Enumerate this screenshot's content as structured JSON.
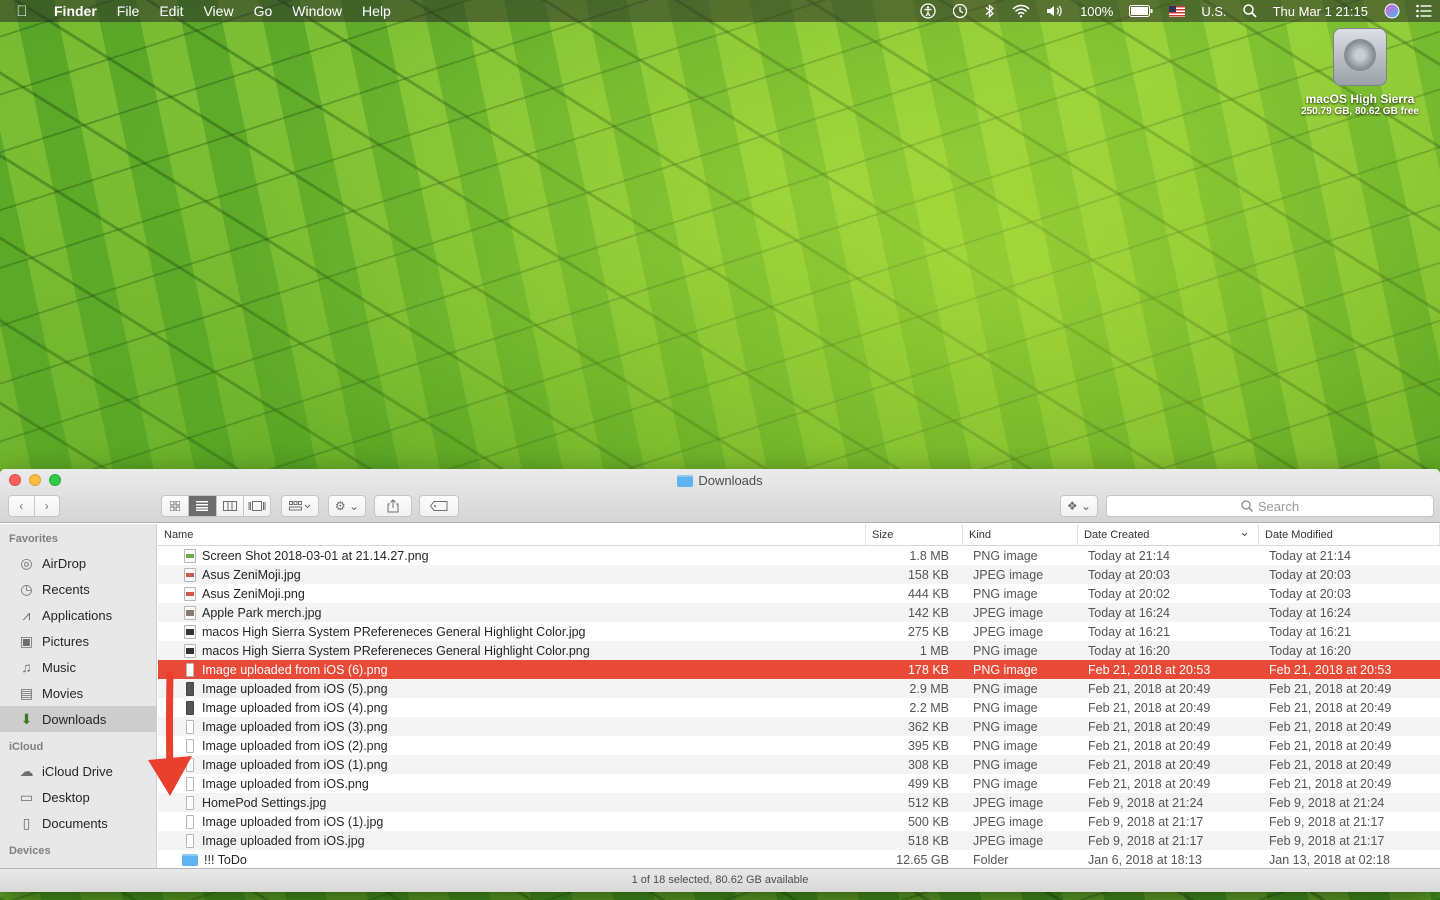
{
  "menubar": {
    "app_name": "Finder",
    "menus": [
      "File",
      "Edit",
      "View",
      "Go",
      "Window",
      "Help"
    ],
    "battery": "100%",
    "input_source": "U.S.",
    "clock": "Thu Mar 1  21:15"
  },
  "desktop": {
    "disk_name": "macOS High Sierra",
    "disk_info": "250.79 GB, 80.62 GB free"
  },
  "window": {
    "title": "Downloads",
    "search_placeholder": "Search",
    "status": "1 of 18 selected, 80.62 GB available"
  },
  "sidebar": {
    "sections": [
      {
        "heading": "Favorites",
        "items": [
          {
            "label": "AirDrop",
            "icon": "airdrop-icon",
            "glyph": "◎"
          },
          {
            "label": "Recents",
            "icon": "recents-icon",
            "glyph": "◷"
          },
          {
            "label": "Applications",
            "icon": "applications-icon",
            "glyph": "⩘"
          },
          {
            "label": "Pictures",
            "icon": "pictures-icon",
            "glyph": "▣"
          },
          {
            "label": "Music",
            "icon": "music-icon",
            "glyph": "♫"
          },
          {
            "label": "Movies",
            "icon": "movies-icon",
            "glyph": "▤"
          },
          {
            "label": "Downloads",
            "icon": "downloads-icon",
            "glyph": "⬇",
            "selected": true
          }
        ]
      },
      {
        "heading": "iCloud",
        "items": [
          {
            "label": "iCloud Drive",
            "icon": "icloud-icon",
            "glyph": "☁"
          },
          {
            "label": "Desktop",
            "icon": "desktop-icon",
            "glyph": "▭"
          },
          {
            "label": "Documents",
            "icon": "documents-icon",
            "glyph": "▯"
          }
        ]
      },
      {
        "heading": "Devices",
        "items": []
      }
    ]
  },
  "columns": {
    "name": "Name",
    "size": "Size",
    "kind": "Kind",
    "created": "Date Created",
    "modified": "Date Modified"
  },
  "files": [
    {
      "name": "Screen Shot 2018-03-01 at 21.14.27.png",
      "size": "1.8 MB",
      "kind": "PNG image",
      "created": "Today at 21:14",
      "modified": "Today at 21:14",
      "thumb": "thumb-green"
    },
    {
      "name": "Asus ZeniMoji.jpg",
      "size": "158 KB",
      "kind": "JPEG image",
      "created": "Today at 20:03",
      "modified": "Today at 20:03",
      "thumb": "thumb-red"
    },
    {
      "name": "Asus ZeniMoji.png",
      "size": "444 KB",
      "kind": "PNG image",
      "created": "Today at 20:02",
      "modified": "Today at 20:03",
      "thumb": "thumb-red"
    },
    {
      "name": "Apple Park merch.jpg",
      "size": "142 KB",
      "kind": "JPEG image",
      "created": "Today at 16:24",
      "modified": "Today at 16:24",
      "thumb": "thumb-photo"
    },
    {
      "name": "macos High Sierra System PRefereneces General Highlight Color.jpg",
      "size": "275 KB",
      "kind": "JPEG image",
      "created": "Today at 16:21",
      "modified": "Today at 16:21",
      "thumb": "thumb-dark"
    },
    {
      "name": "macos High Sierra System PRefereneces General Highlight Color.png",
      "size": "1 MB",
      "kind": "PNG image",
      "created": "Today at 16:20",
      "modified": "Today at 16:20",
      "thumb": "thumb-dark"
    },
    {
      "name": "Image uploaded from iOS (6).png",
      "size": "178 KB",
      "kind": "PNG image",
      "created": "Feb 21, 2018 at 20:53",
      "modified": "Feb 21, 2018 at 20:53",
      "thumb": "thumb-phone",
      "selected": true
    },
    {
      "name": "Image uploaded from iOS (5).png",
      "size": "2.9 MB",
      "kind": "PNG image",
      "created": "Feb 21, 2018 at 20:49",
      "modified": "Feb 21, 2018 at 20:49",
      "thumb": "thumb-phonedark"
    },
    {
      "name": "Image uploaded from iOS (4).png",
      "size": "2.2 MB",
      "kind": "PNG image",
      "created": "Feb 21, 2018 at 20:49",
      "modified": "Feb 21, 2018 at 20:49",
      "thumb": "thumb-phonedark"
    },
    {
      "name": "Image uploaded from iOS (3).png",
      "size": "362 KB",
      "kind": "PNG image",
      "created": "Feb 21, 2018 at 20:49",
      "modified": "Feb 21, 2018 at 20:49",
      "thumb": "thumb-phone"
    },
    {
      "name": "Image uploaded from iOS (2).png",
      "size": "395 KB",
      "kind": "PNG image",
      "created": "Feb 21, 2018 at 20:49",
      "modified": "Feb 21, 2018 at 20:49",
      "thumb": "thumb-phone"
    },
    {
      "name": "Image uploaded from iOS (1).png",
      "size": "308 KB",
      "kind": "PNG image",
      "created": "Feb 21, 2018 at 20:49",
      "modified": "Feb 21, 2018 at 20:49",
      "thumb": "thumb-phone"
    },
    {
      "name": "Image uploaded from iOS.png",
      "size": "499 KB",
      "kind": "PNG image",
      "created": "Feb 21, 2018 at 20:49",
      "modified": "Feb 21, 2018 at 20:49",
      "thumb": "thumb-phone"
    },
    {
      "name": "HomePod Settings.jpg",
      "size": "512 KB",
      "kind": "JPEG image",
      "created": "Feb 9, 2018 at 21:24",
      "modified": "Feb 9, 2018 at 21:24",
      "thumb": "thumb-phone"
    },
    {
      "name": "Image uploaded from iOS (1).jpg",
      "size": "500 KB",
      "kind": "JPEG image",
      "created": "Feb 9, 2018 at 21:17",
      "modified": "Feb 9, 2018 at 21:17",
      "thumb": "thumb-phone"
    },
    {
      "name": "Image uploaded from iOS.jpg",
      "size": "518 KB",
      "kind": "JPEG image",
      "created": "Feb 9, 2018 at 21:17",
      "modified": "Feb 9, 2018 at 21:17",
      "thumb": "thumb-phone"
    },
    {
      "name": "!!! ToDo",
      "size": "12.65 GB",
      "kind": "Folder",
      "created": "Jan 6, 2018 at 18:13",
      "modified": "Jan 13, 2018 at 02:18",
      "thumb": "folder"
    }
  ],
  "colors": {
    "selection": "#e84a37",
    "annotation_arrow": "#e8402c"
  }
}
